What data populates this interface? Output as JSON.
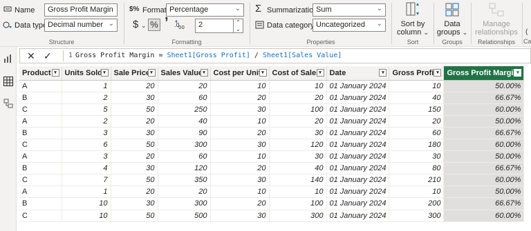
{
  "ribbon": {
    "structure": {
      "name_label": "Name",
      "name_value": "Gross Profit Margin",
      "datatype_label": "Data type",
      "datatype_value": "Decimal number",
      "group_label": "Structure"
    },
    "formatting": {
      "format_label": "Format",
      "format_value": "Percentage",
      "currency_symbol": "$",
      "percent_symbol": "%",
      "comma_symbol": "’",
      "decimals_value": "2",
      "group_label": "Formatting"
    },
    "properties": {
      "summarization_label": "Summarization",
      "summarization_value": "Sum",
      "category_label": "Data category",
      "category_value": "Uncategorized",
      "group_label": "Properties"
    },
    "sort": {
      "button_line1": "Sort by",
      "button_line2": "column",
      "group_label": "Sort"
    },
    "groups": {
      "button_line1": "Data",
      "button_line2": "groups",
      "group_label": "Groups"
    },
    "relationships": {
      "button_line1": "Manage",
      "button_line2": "relationships",
      "group_label": "Relationships"
    },
    "calc_partial": "Ca"
  },
  "formula": {
    "line_number": "1",
    "text_prefix": "Gross Profit Margin = ",
    "ref1": "Sheet1[Gross Profit]",
    "op": " / ",
    "ref2": "Sheet1[Sales Value]"
  },
  "table": {
    "columns": [
      "Product",
      "Units Sold",
      "Sale Price",
      "Sales Value",
      "Cost per Unit",
      "Cost of Sales",
      "Date",
      "Gross Profit",
      "Gross Profit Margin"
    ],
    "rows": [
      [
        "A",
        "1",
        "20",
        "20",
        "10",
        "10",
        "01 January 2024",
        "10",
        "50.00%"
      ],
      [
        "B",
        "2",
        "30",
        "60",
        "20",
        "20",
        "01 January 2024",
        "40",
        "66.67%"
      ],
      [
        "C",
        "5",
        "50",
        "250",
        "30",
        "100",
        "01 January 2024",
        "150",
        "60.00%"
      ],
      [
        "A",
        "2",
        "20",
        "40",
        "10",
        "20",
        "01 January 2024",
        "20",
        "50.00%"
      ],
      [
        "B",
        "3",
        "30",
        "90",
        "20",
        "30",
        "01 January 2024",
        "60",
        "66.67%"
      ],
      [
        "C",
        "6",
        "50",
        "300",
        "30",
        "120",
        "01 January 2024",
        "180",
        "60.00%"
      ],
      [
        "A",
        "3",
        "20",
        "60",
        "10",
        "30",
        "01 January 2024",
        "30",
        "50.00%"
      ],
      [
        "B",
        "4",
        "30",
        "120",
        "20",
        "40",
        "01 January 2024",
        "80",
        "66.67%"
      ],
      [
        "C",
        "7",
        "50",
        "350",
        "30",
        "140",
        "01 January 2024",
        "210",
        "60.00%"
      ],
      [
        "A",
        "1",
        "20",
        "20",
        "10",
        "10",
        "01 January 2024",
        "10",
        "50.00%"
      ],
      [
        "B",
        "10",
        "30",
        "300",
        "20",
        "100",
        "01 January 2024",
        "200",
        "66.67%"
      ],
      [
        "C",
        "10",
        "50",
        "500",
        "30",
        "300",
        "01 January 2024",
        "300",
        "60.00%"
      ]
    ]
  },
  "colors": {
    "accent": "#217346",
    "formula_ref": "#0e6fc3",
    "ribbon_bg": "#f3f2f1"
  }
}
